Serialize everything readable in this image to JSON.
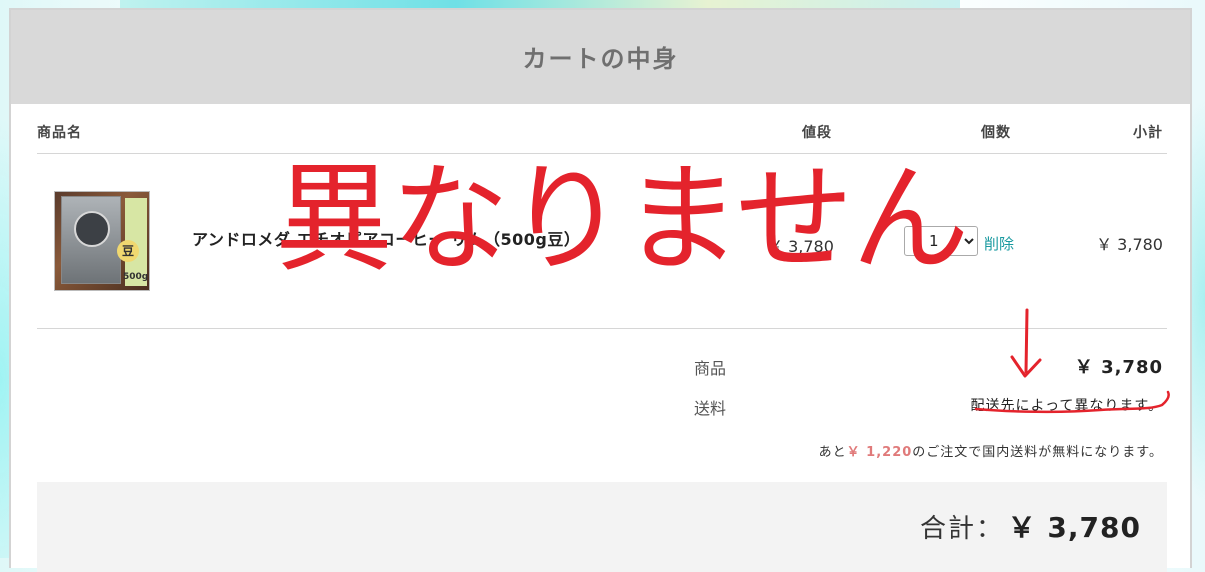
{
  "cart": {
    "title": "カートの中身",
    "columns": {
      "name": "商品名",
      "price": "値段",
      "qty": "個数",
      "subtotal": "小計"
    },
    "items": [
      {
        "name": "アンドロメダ エチオピアコーヒー リム（500g豆）",
        "image_text": "豆",
        "image_weight": "500g",
        "price": "￥ 3,780",
        "qty": "1",
        "delete_label": "削除",
        "subtotal": "￥ 3,780"
      }
    ]
  },
  "summary": {
    "goods_label": "商品",
    "goods_value": "￥ 3,780",
    "shipping_label": "送料",
    "shipping_value": "配送先によって異なります。",
    "free_shipping_prefix": "あと",
    "free_shipping_amount": "￥ 1,220",
    "free_shipping_suffix": "のご注文で国内送料が無料になります。"
  },
  "total": {
    "label": "合計：",
    "value": "￥ 3,780"
  },
  "annotation": {
    "text": "異なりません",
    "color": "#e4232c"
  },
  "colors": {
    "header_bg": "#d9d9d9",
    "link": "#1a9aa0",
    "free_amount": "#e07a7a"
  }
}
